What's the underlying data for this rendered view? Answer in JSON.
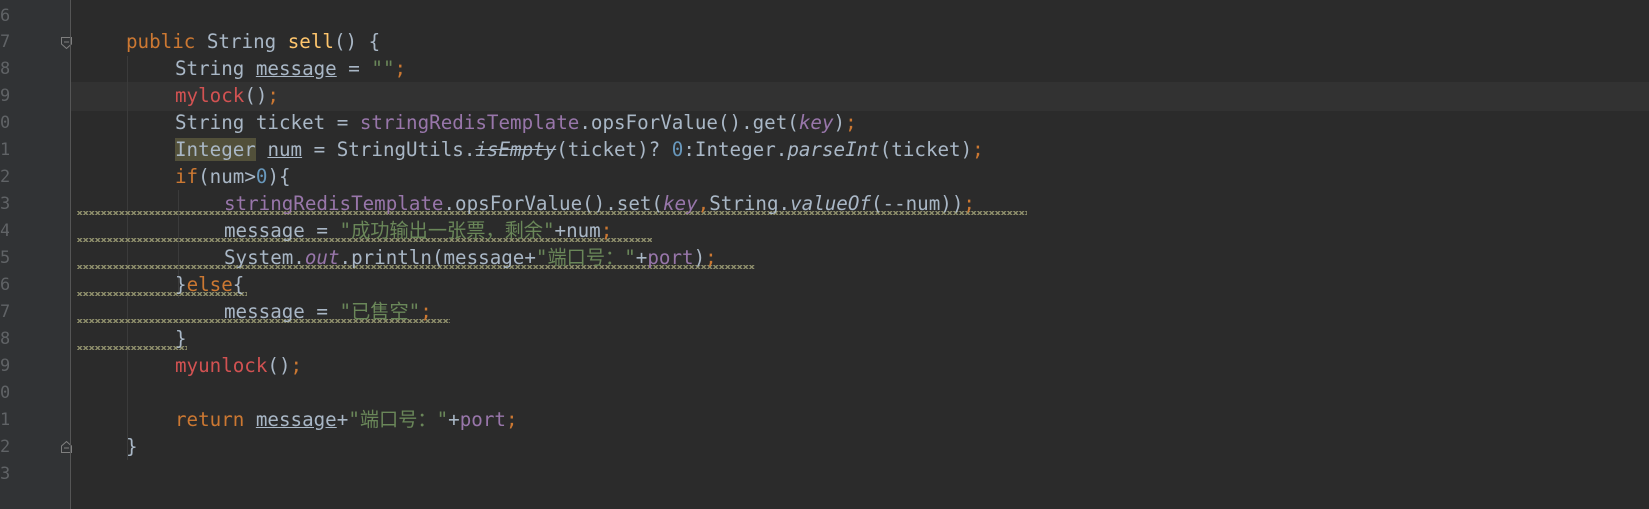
{
  "editor": {
    "line_numbers": [
      "6",
      "7",
      "8",
      "9",
      "0",
      "1",
      "2",
      "3",
      "4",
      "5",
      "6",
      "7",
      "8",
      "9",
      "0",
      "1",
      "2",
      "3"
    ],
    "lines": {
      "l7": {
        "kw_public": "public",
        "t_string": "String",
        "fn_sell": "sell",
        "rest": "() {"
      },
      "l8": {
        "t_string": "String",
        "var_message": "message",
        "eq": " = ",
        "str_empty": "\"\"",
        "semi": ";"
      },
      "l9": {
        "call_mylock": "mylock",
        "rest": "()",
        "semi": ";"
      },
      "l10": {
        "t_string": "String",
        "mid": " ticket = ",
        "field_template": "stringRedisTemplate",
        "call": ".opsForValue().get(",
        "field_key": "key",
        "close": ")",
        "semi": ";"
      },
      "l11": {
        "t_integer": "Integer",
        "sp": " ",
        "var_num": "num",
        "mid": " = StringUtils.",
        "m_isempty": "isEmpty",
        "mid2": "(ticket)? ",
        "num_zero": "0",
        "mid3": ":Integer.",
        "m_parseint": "parseInt",
        "close": "(ticket)",
        "semi": ";"
      },
      "l12": {
        "kw_if": "if",
        "mid": "(num>",
        "num_zero": "0",
        "close": "){"
      },
      "l13": {
        "field_template": "stringRedisTemplate",
        "call": ".opsForValue().set(",
        "field_key": "key",
        "comma": ",",
        "t_string": "String.",
        "m_valueof": "valueOf",
        "close": "(--num))",
        "semi": ";"
      },
      "l14": {
        "var": "message = ",
        "str": "\"成功输出一张票，剩余\"",
        "rest": "+num",
        "semi": ";"
      },
      "l15": {
        "sys": "System.",
        "field_out": "out",
        "call": ".println(message+",
        "str": "\"端口号：\"",
        "plus": "+",
        "field_port": "port",
        "close": ")",
        "semi": ";"
      },
      "l16": {
        "brace": "}",
        "kw_else": "else",
        "open": "{"
      },
      "l17": {
        "var": "message = ",
        "str": "\"已售空\"",
        "semi": ";"
      },
      "l18": {
        "brace": "}"
      },
      "l19": {
        "call_myunlock": "myunlock",
        "rest": "()",
        "semi": ";"
      },
      "l21": {
        "kw_return": "return",
        "sp": " ",
        "var_message": "message",
        "plus": "+",
        "str": "\"端口号：\"",
        "plus2": "+",
        "field_port": "port",
        "semi": ";"
      },
      "l22": {
        "brace": "}"
      }
    }
  }
}
